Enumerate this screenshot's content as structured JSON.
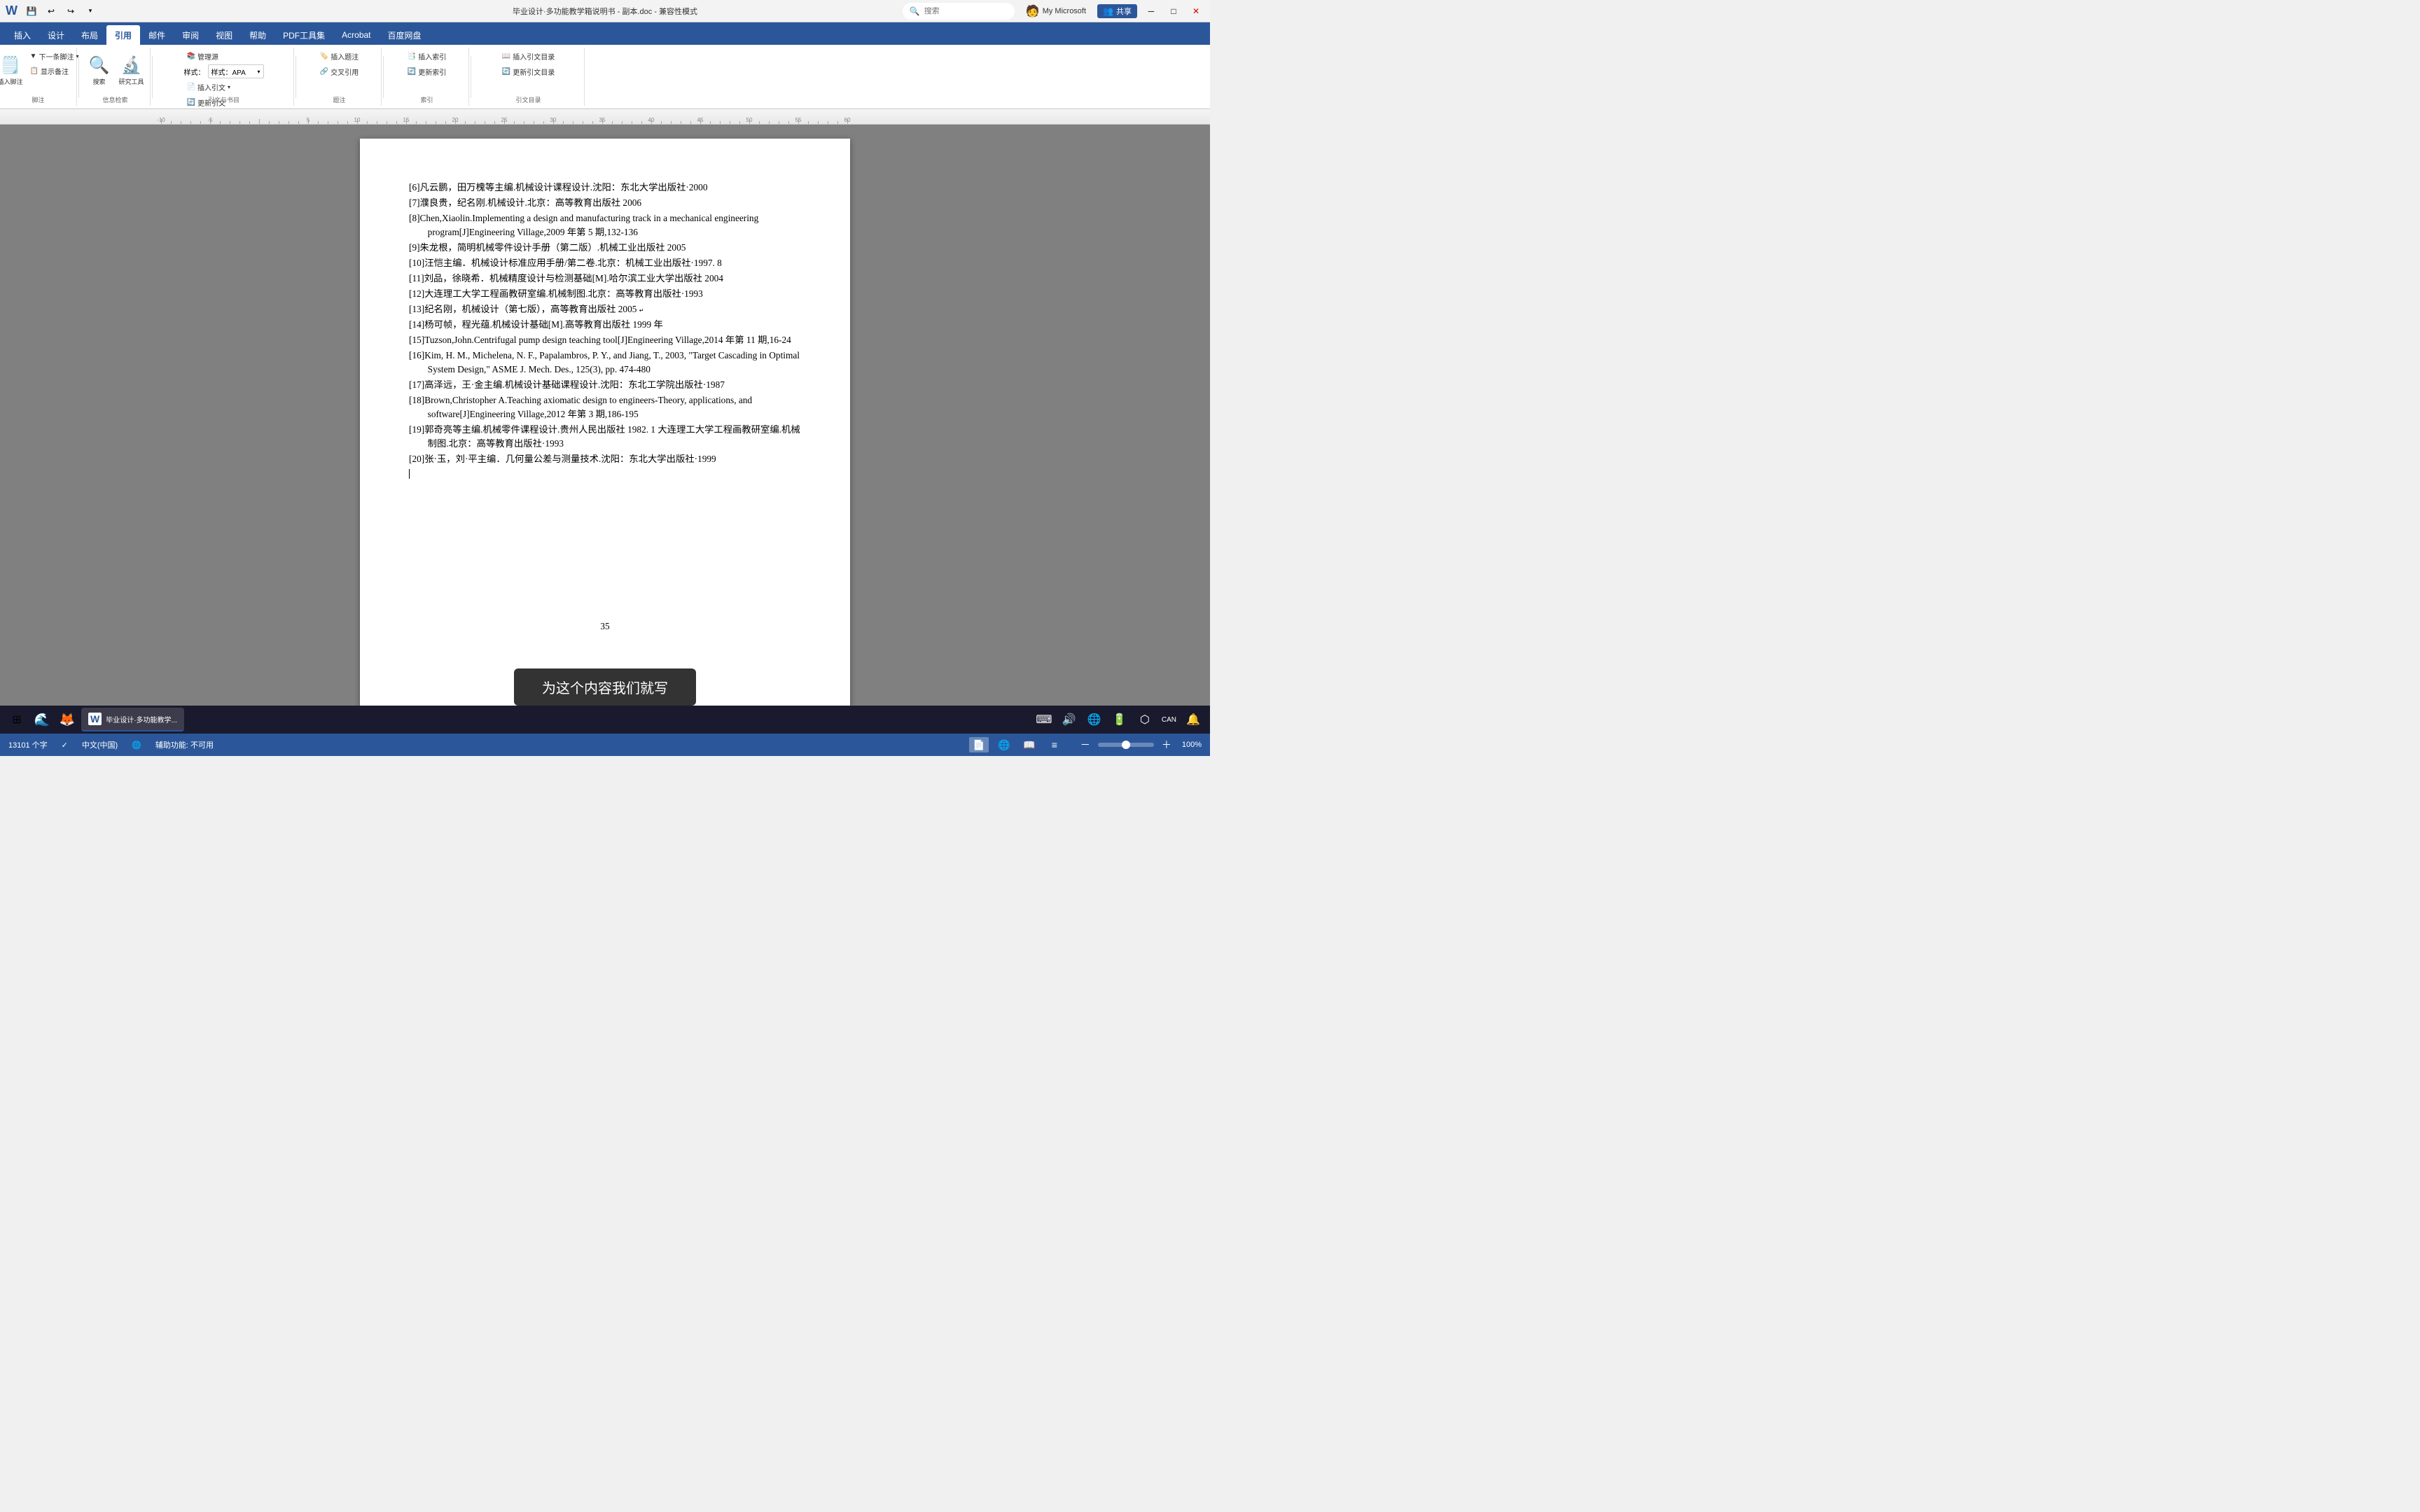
{
  "titlebar": {
    "title": "毕业设计·多功能教学箱说明书 - 副本.doc - 兼容性模式",
    "undo_label": "↩",
    "redo_label": "↪",
    "save_label": "💾",
    "customize_label": "▾",
    "search_placeholder": "搜索",
    "account_label": "My Microsoft",
    "share_label": "共享",
    "share_icon": "👥"
  },
  "ribbon": {
    "tabs": [
      "插入",
      "设计",
      "布局",
      "引用",
      "邮件",
      "审阅",
      "视图",
      "帮助",
      "PDF工具集",
      "Acrobat",
      "百度网盘"
    ],
    "active_tab": "引用",
    "groups": {
      "footnotes": {
        "label": "脚注",
        "insert_footnote": "插入脚注",
        "next_footnote": "下一条脚注",
        "show_notes": "显示备注"
      },
      "citations": {
        "label": "引文与书目",
        "manage_sources": "管理源",
        "style_label": "样式：APA",
        "insert_citation": "插入引文",
        "update_citations": "更新引文"
      },
      "captions": {
        "label": "题注",
        "insert_caption": "插入题注",
        "cross_reference": "交叉引用"
      },
      "index": {
        "label": "索引",
        "insert_index": "插入索引",
        "update_index": "更新索引"
      },
      "toc": {
        "label": "引文目录",
        "insert_toc": "插入引文目录",
        "update_toc": "更新引文目录"
      },
      "research": {
        "label": "信息检索",
        "search": "搜索",
        "research_tool": "研究工具"
      }
    }
  },
  "document": {
    "references": [
      "[6]凡云鹏，田万槐等主编.机械设计课程设计.沈阳：东北大学出版社·2000↵",
      "[7]濮良贵，纪名刚.机械设计.北京：高等教育出版社 2006↵",
      "[8]Chen,Xiaolin.Implementing a design and manufacturing track in a mechanical engineering program[J]Engineering Village,2009 年第 5 期,132-136↵",
      "[9]朱龙根，简明机械零件设计手册（第二版）.机械工业出版社 2005↵",
      "[10]汪恺主编．机械设计标准应用手册/第二卷.北京：机械工业出版社·1997. 8↵",
      "[11]刘品，徐晓希．机械精度设计与检测基础[M].哈尔滨工业大学出版社 2004↵",
      "[12]大连理工大学工程画教研室编.机械制图.北京：高等教育出版社·1993↵",
      "[13]纪名刚，机械设计（第七版），高等教育出版社 2005 ↵",
      "[14]杨可帧，程光蕴.机械设计基础[M].高等教育出版社 1999 年↵",
      "[15]Tuzson,John.Centrifugal pump design teaching tool[J]Engineering Village,2014 年第 11 期,16-24↵",
      "[16]Kim, H. M., Michelena, N. F., Papalambros, P. Y., and Jiang, T., 2003, \"Target Cascading in Optimal System Design,\" ASME J. Mech. Des., 125(3), pp. 474-480↵",
      "[17]高泽远，王·金主编.机械设计基础课程设计.沈阳：东北工学院出版社·1987↵",
      "[18]Brown,Christopher A.Teaching axiomatic design to engineers-Theory, applications, and software[J]Engineering Village,2012 年第 3 期,186-195↵",
      "[19]郭奇亮等主编.机械零件课程设计.贵州人民出版社 1982. 1 大连理工大学工程画教研室编.机械制图.北京：高等教育出版社·1993↵",
      "[20]张·玉，刘·平主编．几何量公差与测量技术.沈阳：东北大学出版社·1999↵"
    ],
    "page_number": "35",
    "cursor_after": "[20]张·玉，刘·平主编．几何量公差与测量技术.沈阳：东北大学出版社·1999↵"
  },
  "statusbar": {
    "word_count": "13101 个字",
    "language": "中文(中国)",
    "icon1": "✓",
    "accessibility": "辅助功能: 不可用",
    "view_icons": [
      "📄",
      "📋",
      "📄",
      "📄"
    ],
    "zoom": "100%",
    "zoom_level": 100
  },
  "taskbar": {
    "start_icon": "⊞",
    "apps": [
      {
        "icon": "🔵",
        "label": ""
      },
      {
        "icon": "🦊",
        "label": ""
      },
      {
        "icon": "W",
        "label": "毕业设计·多功能教学..."
      }
    ],
    "tray": {
      "icons": [
        "🔊",
        "🌐",
        "🔋"
      ],
      "time": "CAN",
      "notifications": ""
    }
  },
  "notification": {
    "text": "为这个内容我们就写"
  }
}
